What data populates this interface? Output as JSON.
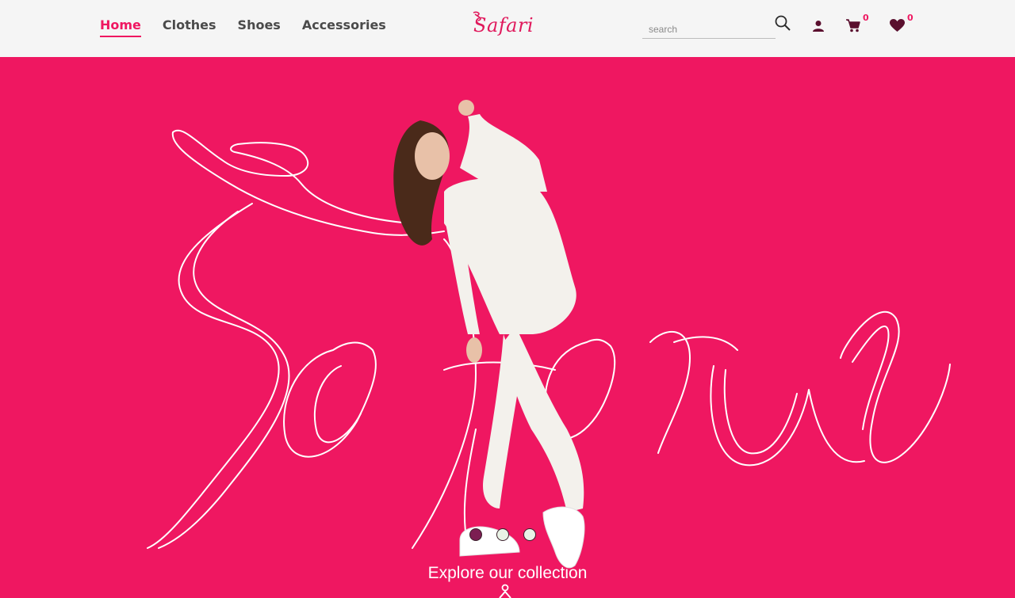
{
  "header": {
    "nav": [
      {
        "label": "Home",
        "active": true
      },
      {
        "label": "Clothes",
        "active": false
      },
      {
        "label": "Shoes",
        "active": false
      },
      {
        "label": "Accessories",
        "active": false
      }
    ],
    "logo_text": "Safari",
    "search": {
      "placeholder": "search",
      "value": ""
    },
    "cart_count": "0",
    "wishlist_count": "0"
  },
  "hero": {
    "background_text": "Safari",
    "carousel": {
      "slides": 3,
      "active_index": 0
    },
    "cta_text": "Explore our collection"
  },
  "colors": {
    "brand": "#ef1761",
    "dot_active": "#7c1e52",
    "icon_dark": "#5a0f2e",
    "nav_text": "#4a4a4a"
  },
  "icons": [
    "search-icon",
    "user-icon",
    "cart-icon",
    "heart-icon",
    "explore-icon"
  ]
}
